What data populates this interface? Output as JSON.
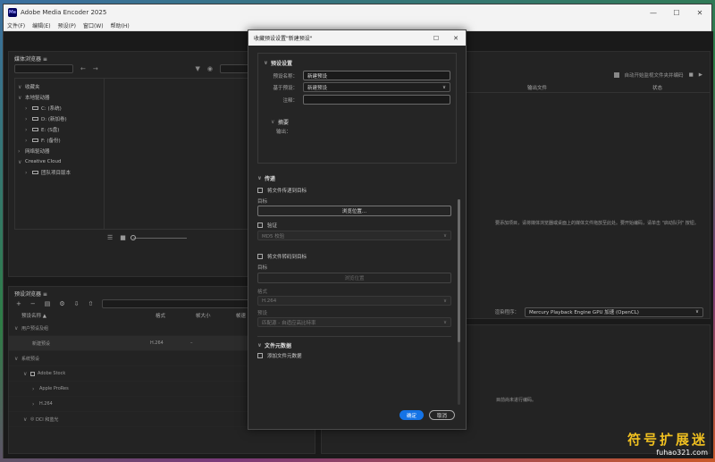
{
  "window": {
    "title": "Adobe Media Encoder 2025",
    "logo": "Me"
  },
  "menu": [
    "文件(F)",
    "编辑(E)",
    "预设(P)",
    "窗口(W)",
    "帮助(H)"
  ],
  "browser": {
    "title": "媒体浏览器",
    "tree": [
      {
        "label": "收藏夹",
        "level": 0
      },
      {
        "label": "本地驱动器",
        "level": 0
      },
      {
        "label": "C: (系统)",
        "level": 1
      },
      {
        "label": "D: (新加卷)",
        "level": 1
      },
      {
        "label": "E: (S盘)",
        "level": 1
      },
      {
        "label": "F: (备份)",
        "level": 1
      },
      {
        "label": "网络驱动器",
        "level": 0
      },
      {
        "label": "Creative Cloud",
        "level": 0
      },
      {
        "label": "团队项目版本",
        "level": 1
      }
    ]
  },
  "presets": {
    "title": "预设浏览器",
    "search_placeholder": "",
    "columns": [
      "预设名称 ▲",
      "格式",
      "帧大小",
      "帧速"
    ],
    "rows": [
      {
        "name": "用户预设及组",
        "format": "",
        "size": "",
        "type": "group"
      },
      {
        "name": "新建预设",
        "format": "H.264",
        "size": "–",
        "type": "selected"
      },
      {
        "name": "系统预设",
        "format": "",
        "size": "",
        "type": "group"
      },
      {
        "name": "Adobe Stock",
        "format": "",
        "size": "",
        "type": "sub"
      },
      {
        "name": "Apple ProRes",
        "format": "",
        "size": "",
        "type": "sub2"
      },
      {
        "name": "H.264",
        "format": "",
        "size": "",
        "type": "sub2"
      },
      {
        "name": "DCI 和蓝光",
        "format": "",
        "size": "",
        "type": "sub"
      }
    ]
  },
  "queue": {
    "autostart": "自动开始监视文件夹并编码",
    "col_output": "输出文件",
    "col_status": "状态",
    "hint": "要添加项目，请将媒体浏览器或桌面上的媒体文件拖放至此处。要开始编码，请单击 \"启动队列\" 按钮。",
    "renderer_label": "渲染程序：",
    "renderer_value": "Mercury Playback Engine GPU 加速 (OpenCL)",
    "idle": "目前尚未进行编码。"
  },
  "dialog": {
    "title": "收藏预设设置\"新建预设\"",
    "preset_settings": "预设设置",
    "preset_name_label": "预设名称：",
    "preset_name_value": "新建预设",
    "based_on_label": "基于预设：",
    "based_on_value": "新建预设",
    "comment_label": "注释：",
    "comment_value": "",
    "summary": "摘要",
    "output_label": "输出：",
    "deliver": "传递",
    "copy_source": "将文件传递到目标",
    "target": "目标",
    "browse": "浏览位置...",
    "verify": "验证",
    "verify_value": "MD5 校验",
    "copy_transcode": "将文件转码到目标",
    "target2": "目标",
    "browse2": "浏览位置",
    "format_label": "格式",
    "format_value": "H.264",
    "preset_label": "预设",
    "preset_value": "匹配源 - 自适应高比特率",
    "metadata": "文件元数据",
    "add_metadata": "添加文件元数据",
    "ok": "确定",
    "cancel": "取消"
  },
  "watermark": {
    "cn": "符号扩展迷",
    "url": "fuhao321.com"
  }
}
